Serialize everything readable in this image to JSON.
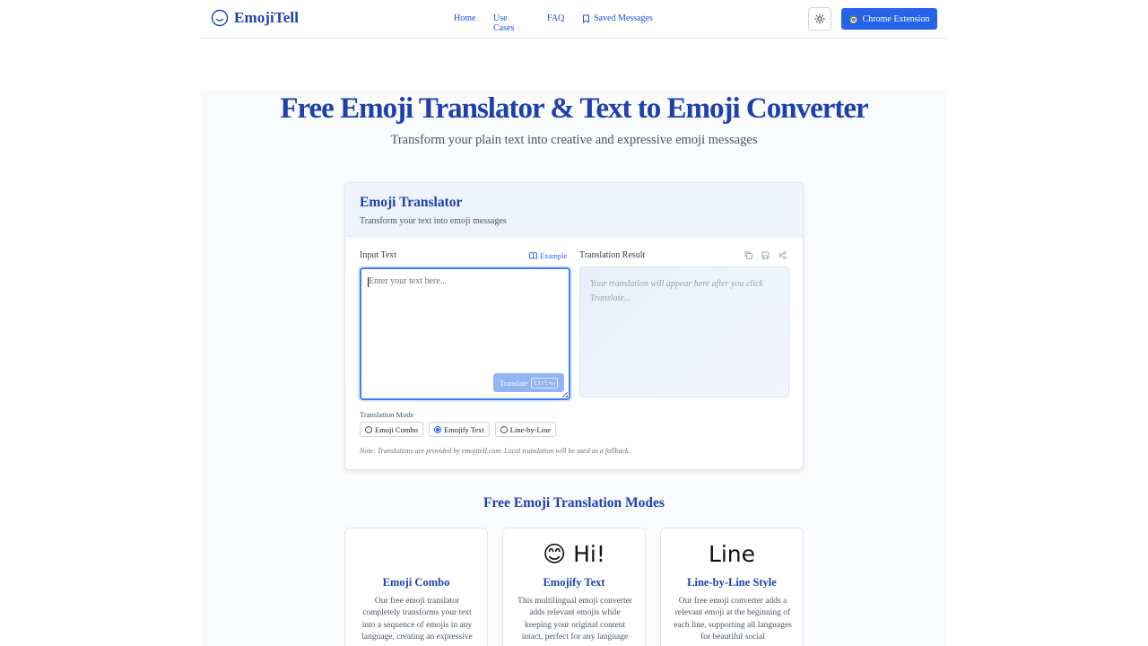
{
  "header": {
    "logo_text": "EmojiTell",
    "nav": [
      {
        "label": "Home"
      },
      {
        "label": "Use Cases"
      },
      {
        "label": "FAQ"
      },
      {
        "label": "Saved Messages"
      }
    ],
    "extension_label": "Chrome Extension"
  },
  "hero": {
    "title": "Free Emoji Translator & Text to Emoji Converter",
    "subtitle": "Transform your plain text into creative and expressive emoji messages"
  },
  "translator": {
    "title": "Emoji Translator",
    "description": "Transform your text into emoji messages",
    "input_label": "Input Text",
    "example_label": "Example",
    "result_label": "Translation Result",
    "input_placeholder": "Enter your text here...",
    "translate_label": "Translate",
    "shortcut": "Ctrl+↵",
    "result_placeholder": "Your translation will appear here after you click Translate...",
    "mode_label": "Translation Mode",
    "modes": [
      {
        "label": "Emoji Combo",
        "selected": false
      },
      {
        "label": "Emojify Text",
        "selected": true
      },
      {
        "label": "Line-by-Line",
        "selected": false
      }
    ],
    "note": "Note: Translations are provided by emojitell.com. Local translation will be used as a fallback."
  },
  "modes_section": {
    "title": "Free Emoji Translation Modes",
    "cards": [
      {
        "preview": "",
        "title": "Emoji Combo",
        "description": "Our free emoji translator completely transforms your text into a sequence of emojis in any language, creating an expressive"
      },
      {
        "preview": "😊 Hi!",
        "title": "Emojify Text",
        "description": "This multilingual emoji converter adds relevant emojis while keeping your original content intact, perfect for any language"
      },
      {
        "preview": "Line",
        "title": "Line-by-Line Style",
        "description": "Our free emoji converter adds a relevant emoji at the beginning of each line, supporting all languages for beautiful social"
      }
    ]
  },
  "colors": {
    "brand": "#1e40af",
    "accent": "#2563eb",
    "translate_disabled": "#93b4f5"
  }
}
